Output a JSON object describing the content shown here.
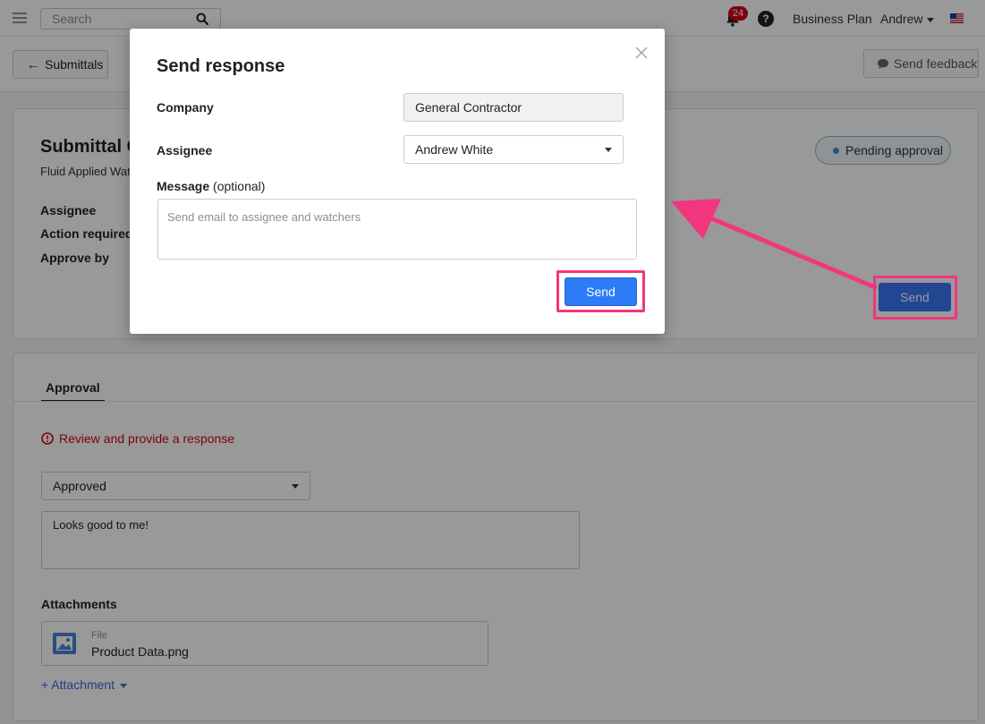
{
  "topbar": {
    "search_placeholder": "Search",
    "notification_count": "24",
    "help_label": "?",
    "plan_label": "Business Plan",
    "user_name": "Andrew"
  },
  "subbar": {
    "back_label": "Submittals",
    "feedback_label": "Send feedback"
  },
  "submittal": {
    "title": "Submittal C",
    "description": "Fluid Applied Wat",
    "fields": [
      "Assignee",
      "Action required",
      "Approve by"
    ],
    "status": "Pending approval",
    "send_label": "Send"
  },
  "approval": {
    "tab_label": "Approval",
    "warning": "Review and provide a response",
    "response_value": "Approved",
    "comment": "Looks good to me!",
    "attachments_label": "Attachments",
    "file_type": "File",
    "file_name": "Product Data.png",
    "add_attachment_label": "+ Attachment"
  },
  "modal": {
    "title": "Send response",
    "company_label": "Company",
    "company_value": "General Contractor",
    "assignee_label": "Assignee",
    "assignee_value": "Andrew White",
    "message_label": "Message",
    "message_optional": "(optional)",
    "message_placeholder": "Send email to assignee and watchers",
    "send_label": "Send"
  },
  "colors": {
    "primary_button": "#2d7bf7",
    "highlight": "#f2367d",
    "warning": "#d0021b",
    "link": "#2d6fd6"
  },
  "icons": [
    "hamburger-icon",
    "search-icon",
    "bell-icon",
    "help-icon",
    "chevron-down-icon",
    "flag-icon",
    "arrow-left-icon",
    "chat-bubble-icon",
    "status-dot-icon",
    "alert-circle-icon",
    "image-file-icon",
    "close-icon"
  ]
}
